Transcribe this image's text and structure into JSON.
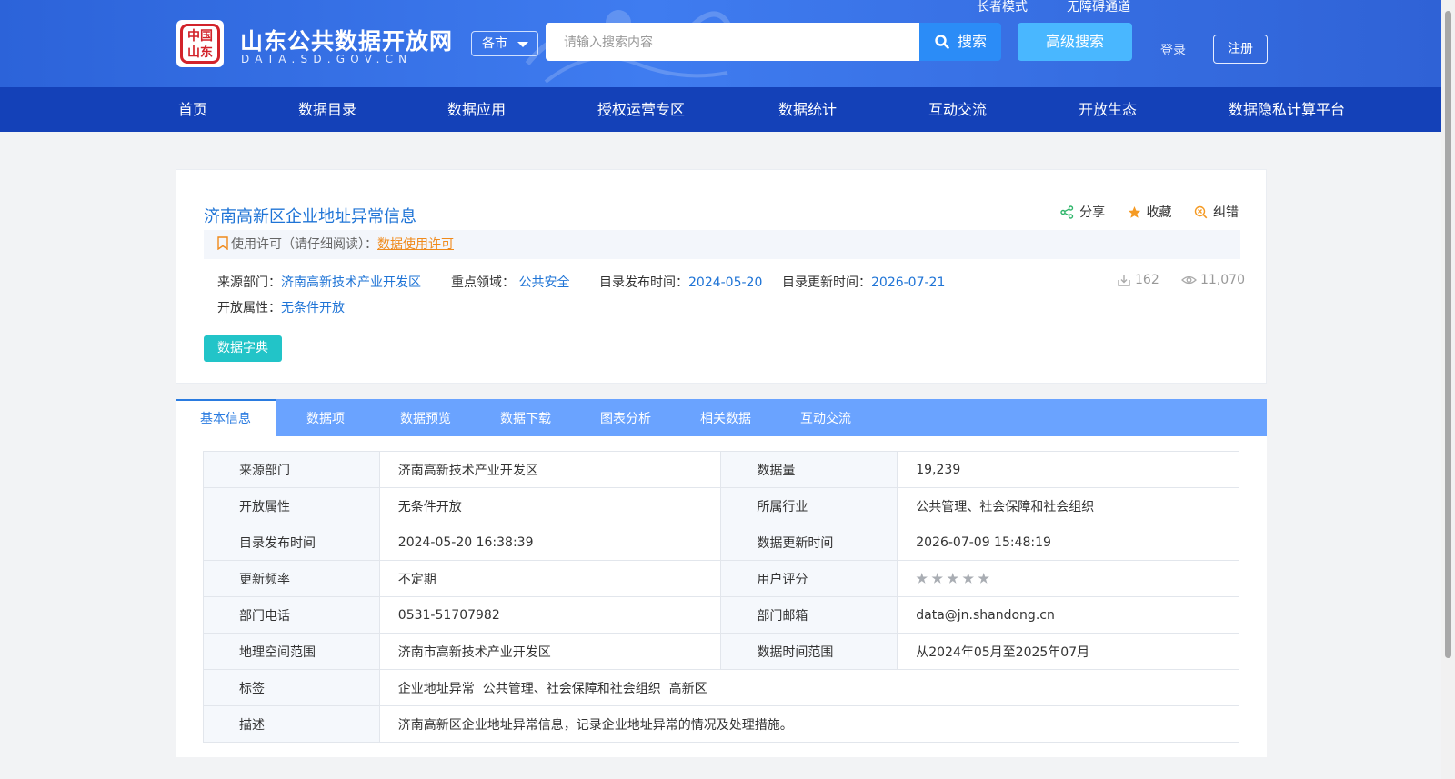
{
  "header": {
    "site_title": "山东公共数据开放网",
    "site_subtitle": "DATA.SD.GOV.CN",
    "seal_text": "中国山东",
    "city_select": "各市",
    "search_placeholder": "请输入搜索内容",
    "search_button": "搜索",
    "advanced_search": "高级搜索",
    "elder_mode": "长者模式",
    "accessibility": "无障碍通道",
    "login": "登录",
    "register": "注册"
  },
  "nav": [
    "首页",
    "数据目录",
    "数据应用",
    "授权运营专区",
    "数据统计",
    "互动交流",
    "开放生态",
    "数据隐私计算平台"
  ],
  "dataset": {
    "title": "济南高新区企业地址异常信息",
    "actions": {
      "share": "分享",
      "favorite": "收藏",
      "correct": "纠错"
    },
    "license_label": "使用许可（请仔细阅读）：",
    "license_link": "数据使用许可",
    "source_label": "来源部门：",
    "source_value": "济南高新技术产业开发区",
    "domain_label": "重点领域：",
    "domain_value": "公共安全",
    "publish_label": "目录发布时间：",
    "publish_value": "2024-05-20",
    "update_label": "目录更新时间：",
    "update_value": "2026-07-21",
    "open_label": "开放属性：",
    "open_value": "无条件开放",
    "downloads": "162",
    "views": "11,070",
    "dict_button": "数据字典"
  },
  "tabs": [
    "基本信息",
    "数据项",
    "数据预览",
    "数据下载",
    "图表分析",
    "相关数据",
    "互动交流"
  ],
  "info_table": {
    "r1": {
      "l1": "来源部门",
      "v1": "济南高新技术产业开发区",
      "l2": "数据量",
      "v2": "19,239"
    },
    "r2": {
      "l1": "开放属性",
      "v1": "无条件开放",
      "l2": "所属行业",
      "v2": "公共管理、社会保障和社会组织"
    },
    "r3": {
      "l1": "目录发布时间",
      "v1": "2024-05-20 16:38:39",
      "l2": "数据更新时间",
      "v2": "2026-07-09 15:48:19"
    },
    "r4": {
      "l1": "更新频率",
      "v1": "不定期",
      "l2": "用户评分",
      "rating": 0,
      "rating_max": 5
    },
    "r5": {
      "l1": "部门电话",
      "v1": "0531-51707982",
      "l2": "部门邮箱",
      "v2": "data@jn.shandong.cn"
    },
    "r6": {
      "l1": "地理空间范围",
      "v1": "济南市高新技术产业开发区",
      "l2": "数据时间范围",
      "v2": "从2024年05月至2025年07月"
    },
    "r7": {
      "l1": "标签",
      "v1": "企业地址异常  公共管理、社会保障和社会组织  高新区"
    },
    "r8": {
      "l1": "描述",
      "v1": "济南高新区企业地址异常信息，记录企业地址异常的情况及处理措施。"
    }
  },
  "colors": {
    "header_blue": "#3f7cf0",
    "nav_blue": "#1441b8",
    "link_blue": "#1f74d6",
    "license_orange": "#f08a1b",
    "dict_teal": "#22c4c8",
    "tab_bar": "#6aa3ff"
  }
}
